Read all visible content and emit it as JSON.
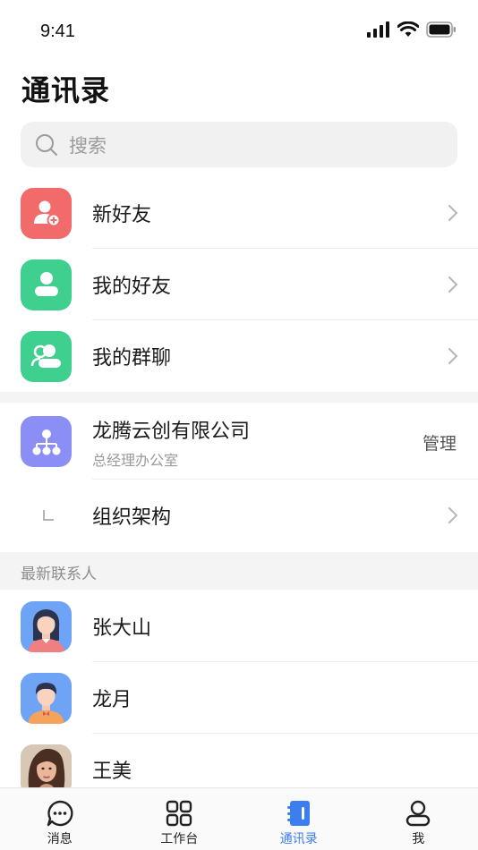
{
  "status_bar": {
    "time": "9:41"
  },
  "page": {
    "title": "通讯录"
  },
  "search": {
    "placeholder": "搜索"
  },
  "quick_entries": [
    {
      "label": "新好友",
      "icon": "add-user-icon",
      "color": "#f26a6a"
    },
    {
      "label": "我的好友",
      "icon": "user-icon",
      "color": "#3fcf8e"
    },
    {
      "label": "我的群聊",
      "icon": "group-icon",
      "color": "#3fcf8e"
    }
  ],
  "organization": {
    "company_name": "龙腾云创有限公司",
    "department": "总经理办公室",
    "manage_label": "管理",
    "structure_label": "组织架构",
    "icon": "org-chart-icon",
    "color": "#8b8ff5"
  },
  "recent": {
    "header": "最新联系人",
    "contacts": [
      {
        "name": "张大山",
        "avatar": "illustrated-avatar-woman"
      },
      {
        "name": "龙月",
        "avatar": "illustrated-avatar-man"
      },
      {
        "name": "王美",
        "avatar": "photo-avatar-woman"
      }
    ]
  },
  "tab_bar": {
    "tabs": [
      {
        "label": "消息",
        "icon": "chat-bubble-icon",
        "active": false
      },
      {
        "label": "工作台",
        "icon": "grid-icon",
        "active": false
      },
      {
        "label": "通讯录",
        "icon": "contacts-book-icon",
        "active": true
      },
      {
        "label": "我",
        "icon": "profile-icon",
        "active": false
      }
    ],
    "active_color": "#3b7ef0"
  }
}
